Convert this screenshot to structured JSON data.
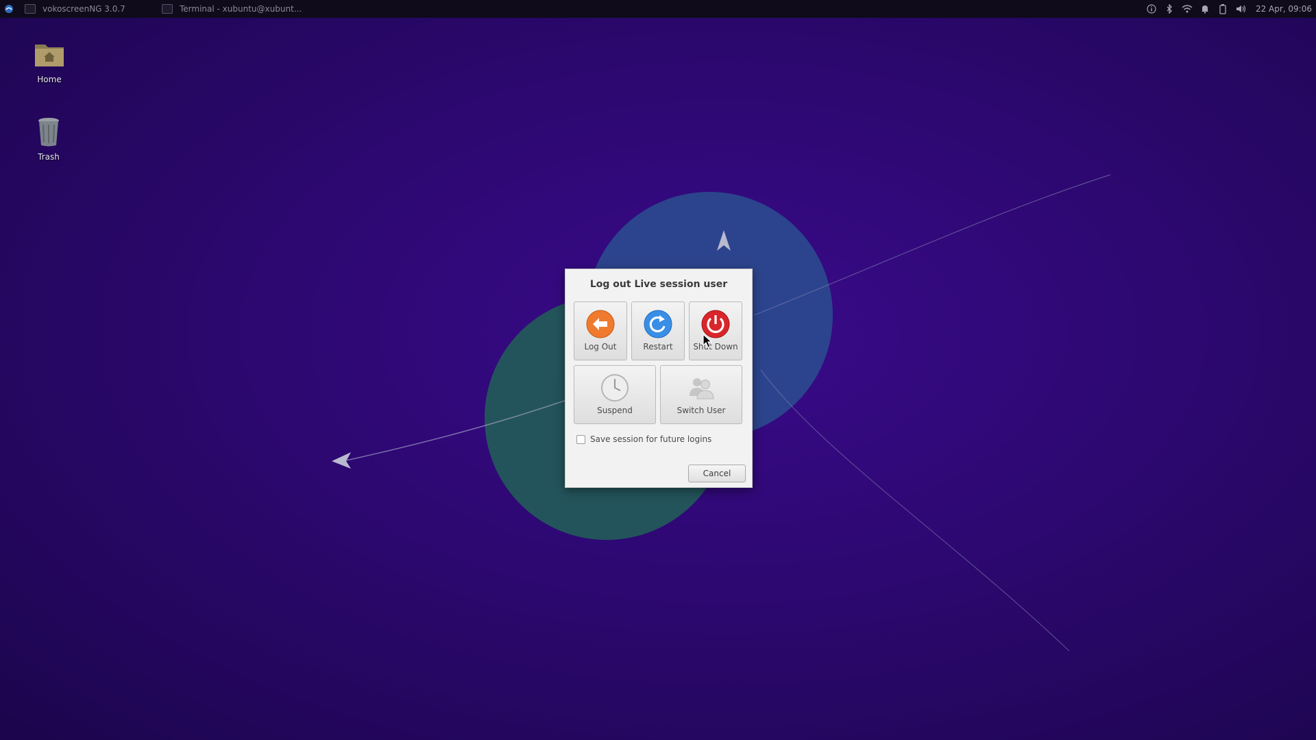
{
  "panel": {
    "tasks": [
      {
        "label": "vokoscreenNG 3.0.7",
        "icon": "video-camera-icon"
      },
      {
        "label": "Terminal - xubuntu@xubunt...",
        "icon": "terminal-icon"
      }
    ],
    "tray_icons": [
      "info-icon",
      "bluetooth-icon",
      "wifi-icon",
      "notification-bell-icon",
      "battery-icon",
      "volume-icon"
    ],
    "clock": "22 Apr, 09:06"
  },
  "desktop": {
    "icons": [
      {
        "label": "Home",
        "icon": "home-folder-icon"
      },
      {
        "label": "Trash",
        "icon": "trash-icon"
      }
    ]
  },
  "dialog": {
    "title": "Log out Live session user",
    "buttons": {
      "logout": "Log Out",
      "restart": "Restart",
      "shutdown": "Shut Down",
      "suspend": "Suspend",
      "switch_user": "Switch User"
    },
    "save_session_label": "Save session for future logins",
    "save_session_checked": false,
    "cancel_label": "Cancel"
  },
  "colors": {
    "logout": "#f07a2e",
    "restart": "#3a8ee6",
    "shutdown": "#d9262a",
    "wallpaper_blue": "#2a4f8f",
    "wallpaper_green": "#23585a",
    "background": "#2c0870"
  }
}
